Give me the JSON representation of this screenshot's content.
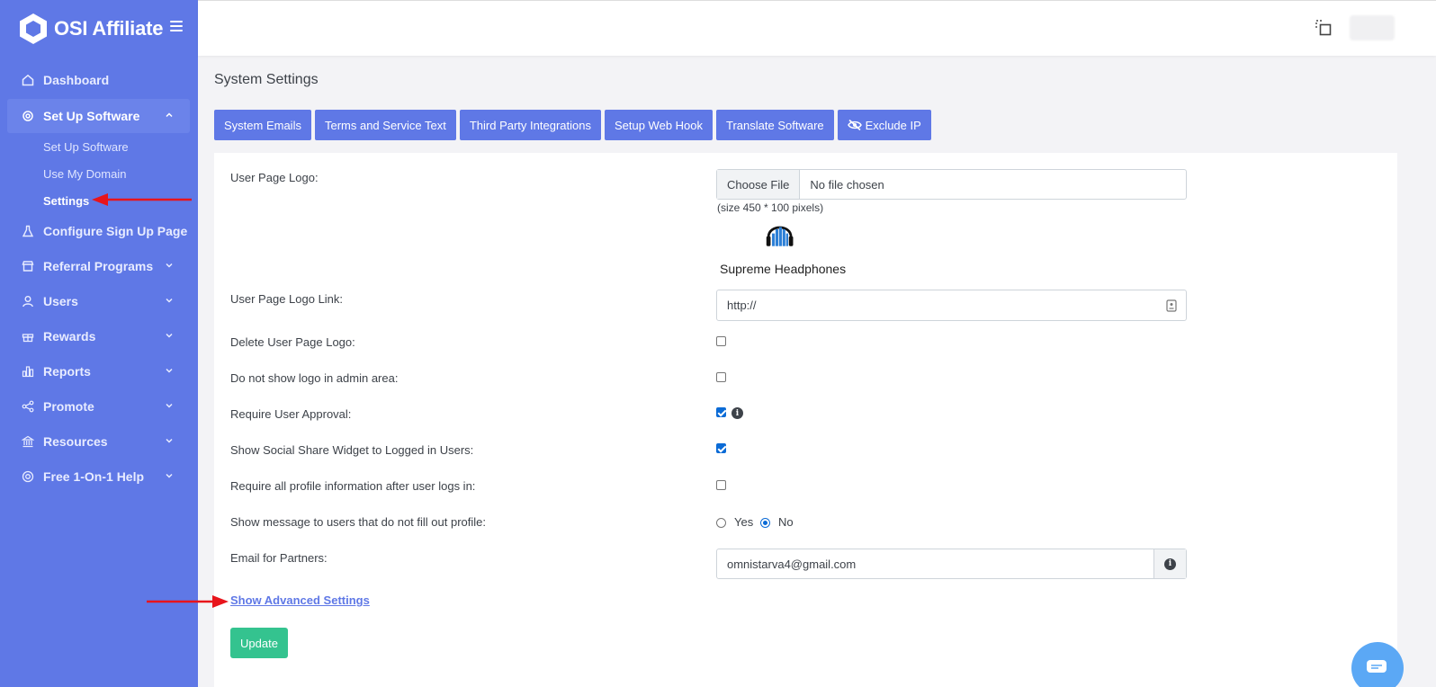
{
  "app": {
    "name": "OSI Affiliate"
  },
  "sidebar": {
    "items": [
      {
        "label": "Dashboard",
        "icon": "home-icon"
      },
      {
        "label": "Set Up Software",
        "icon": "gear-icon",
        "expanded": true
      },
      {
        "label": "Configure Sign Up Page",
        "icon": "flask-icon"
      },
      {
        "label": "Referral Programs",
        "icon": "store-icon"
      },
      {
        "label": "Users",
        "icon": "user-icon"
      },
      {
        "label": "Rewards",
        "icon": "gift-icon"
      },
      {
        "label": "Reports",
        "icon": "bar-chart-icon"
      },
      {
        "label": "Promote",
        "icon": "share-icon"
      },
      {
        "label": "Resources",
        "icon": "bank-icon"
      },
      {
        "label": "Free 1-On-1 Help",
        "icon": "lifebuoy-icon"
      }
    ],
    "subitems": [
      {
        "label": "Set Up Software"
      },
      {
        "label": "Use My Domain"
      },
      {
        "label": "Settings",
        "current": true
      }
    ]
  },
  "page": {
    "title": "System Settings"
  },
  "tabs": [
    {
      "label": "System Emails"
    },
    {
      "label": "Terms and Service Text"
    },
    {
      "label": "Third Party Integrations"
    },
    {
      "label": "Setup Web Hook"
    },
    {
      "label": "Translate Software"
    },
    {
      "label": "Exclude IP",
      "icon": "eye-slash-icon"
    }
  ],
  "form": {
    "user_page_logo": {
      "label": "User Page Logo:",
      "button": "Choose File",
      "status": "No file chosen",
      "note": "(size 450 * 100 pixels)",
      "preview_caption": "Supreme Headphones"
    },
    "logo_link": {
      "label": "User Page Logo Link:",
      "value": "http://"
    },
    "delete_logo": {
      "label": "Delete User Page Logo:",
      "checked": false
    },
    "hide_admin_logo": {
      "label": "Do not show logo in admin area:",
      "checked": false
    },
    "require_approval": {
      "label": "Require User Approval:",
      "checked": true
    },
    "social_share": {
      "label": "Show Social Share Widget to Logged in Users:",
      "checked": true
    },
    "require_profile": {
      "label": "Require all profile information after user logs in:",
      "checked": false
    },
    "show_message": {
      "label": "Show message to users that do not fill out profile:",
      "yes": "Yes",
      "no": "No",
      "selected": "No"
    },
    "partner_email": {
      "label": "Email for Partners:",
      "value": "omnistarva4@gmail.com"
    },
    "advanced_link": "Show Advanced Settings",
    "update_button": "Update"
  },
  "colors": {
    "sidebar": "#5f78e6",
    "accent": "#5f78e6",
    "success": "#34c38f",
    "annotation_arrow": "#e8141b"
  }
}
